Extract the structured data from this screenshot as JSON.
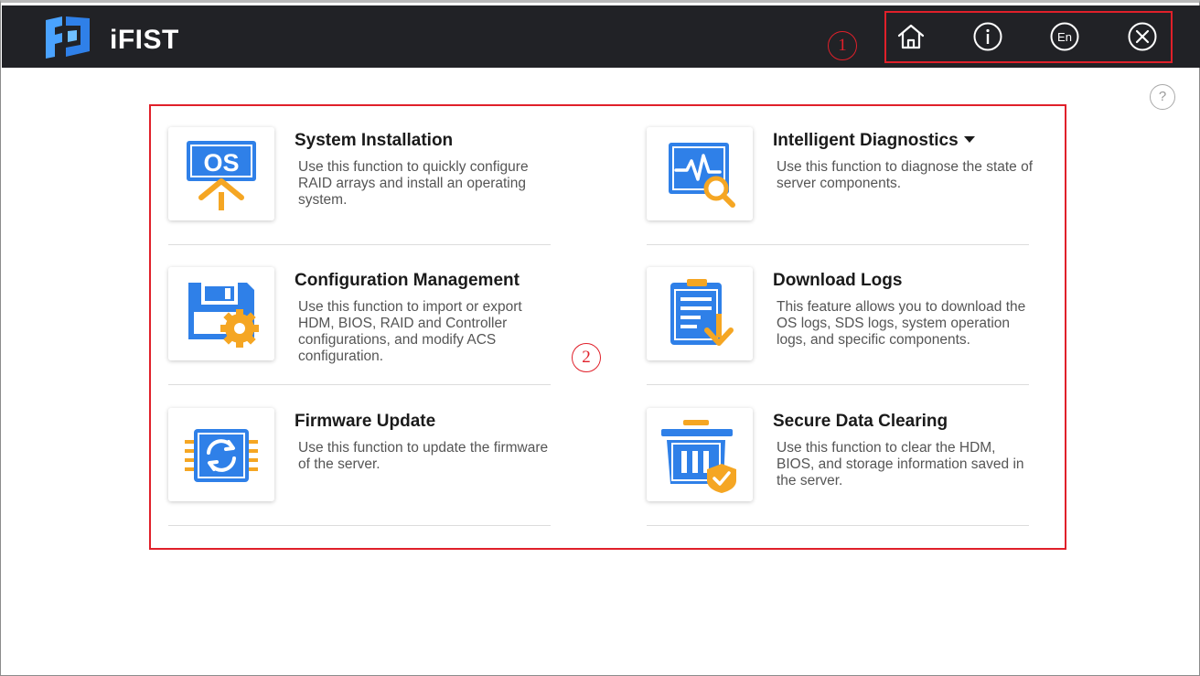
{
  "app": {
    "title": "iFIST"
  },
  "colors": {
    "topbar": "#212226",
    "accent_blue": "#2f80e8",
    "accent_orange": "#f5a623",
    "annotation_red": "#e0202a"
  },
  "annotations": {
    "toolbar_callout": "1",
    "content_callout": "2"
  },
  "toolbar": {
    "buttons": [
      {
        "icon": "home-icon"
      },
      {
        "icon": "info-icon"
      },
      {
        "icon": "language-icon",
        "label": "En"
      },
      {
        "icon": "close-icon"
      }
    ]
  },
  "help": {
    "label": "?"
  },
  "functions": [
    {
      "icon": "os-install-icon",
      "icon_label": "OS",
      "title": "System Installation",
      "description": "Use this function to quickly configure RAID arrays and install an operating system."
    },
    {
      "icon": "diagnostics-icon",
      "title": "Intelligent Diagnostics",
      "has_dropdown": true,
      "description": "Use this function to diagnose the state of server components."
    },
    {
      "icon": "configuration-icon",
      "title": "Configuration Management",
      "description": "Use this function to import or export HDM, BIOS, RAID and Controller configurations, and modify ACS configuration."
    },
    {
      "icon": "download-logs-icon",
      "title": "Download Logs",
      "description": "This feature allows you to download the OS logs, SDS logs, system operation logs, and specific components."
    },
    {
      "icon": "firmware-update-icon",
      "title": "Firmware Update",
      "description": "Use this function to update the firmware of the server."
    },
    {
      "icon": "secure-clear-icon",
      "title": "Secure Data Clearing",
      "description": "Use this function to clear the HDM, BIOS, and storage information saved in the server."
    }
  ]
}
